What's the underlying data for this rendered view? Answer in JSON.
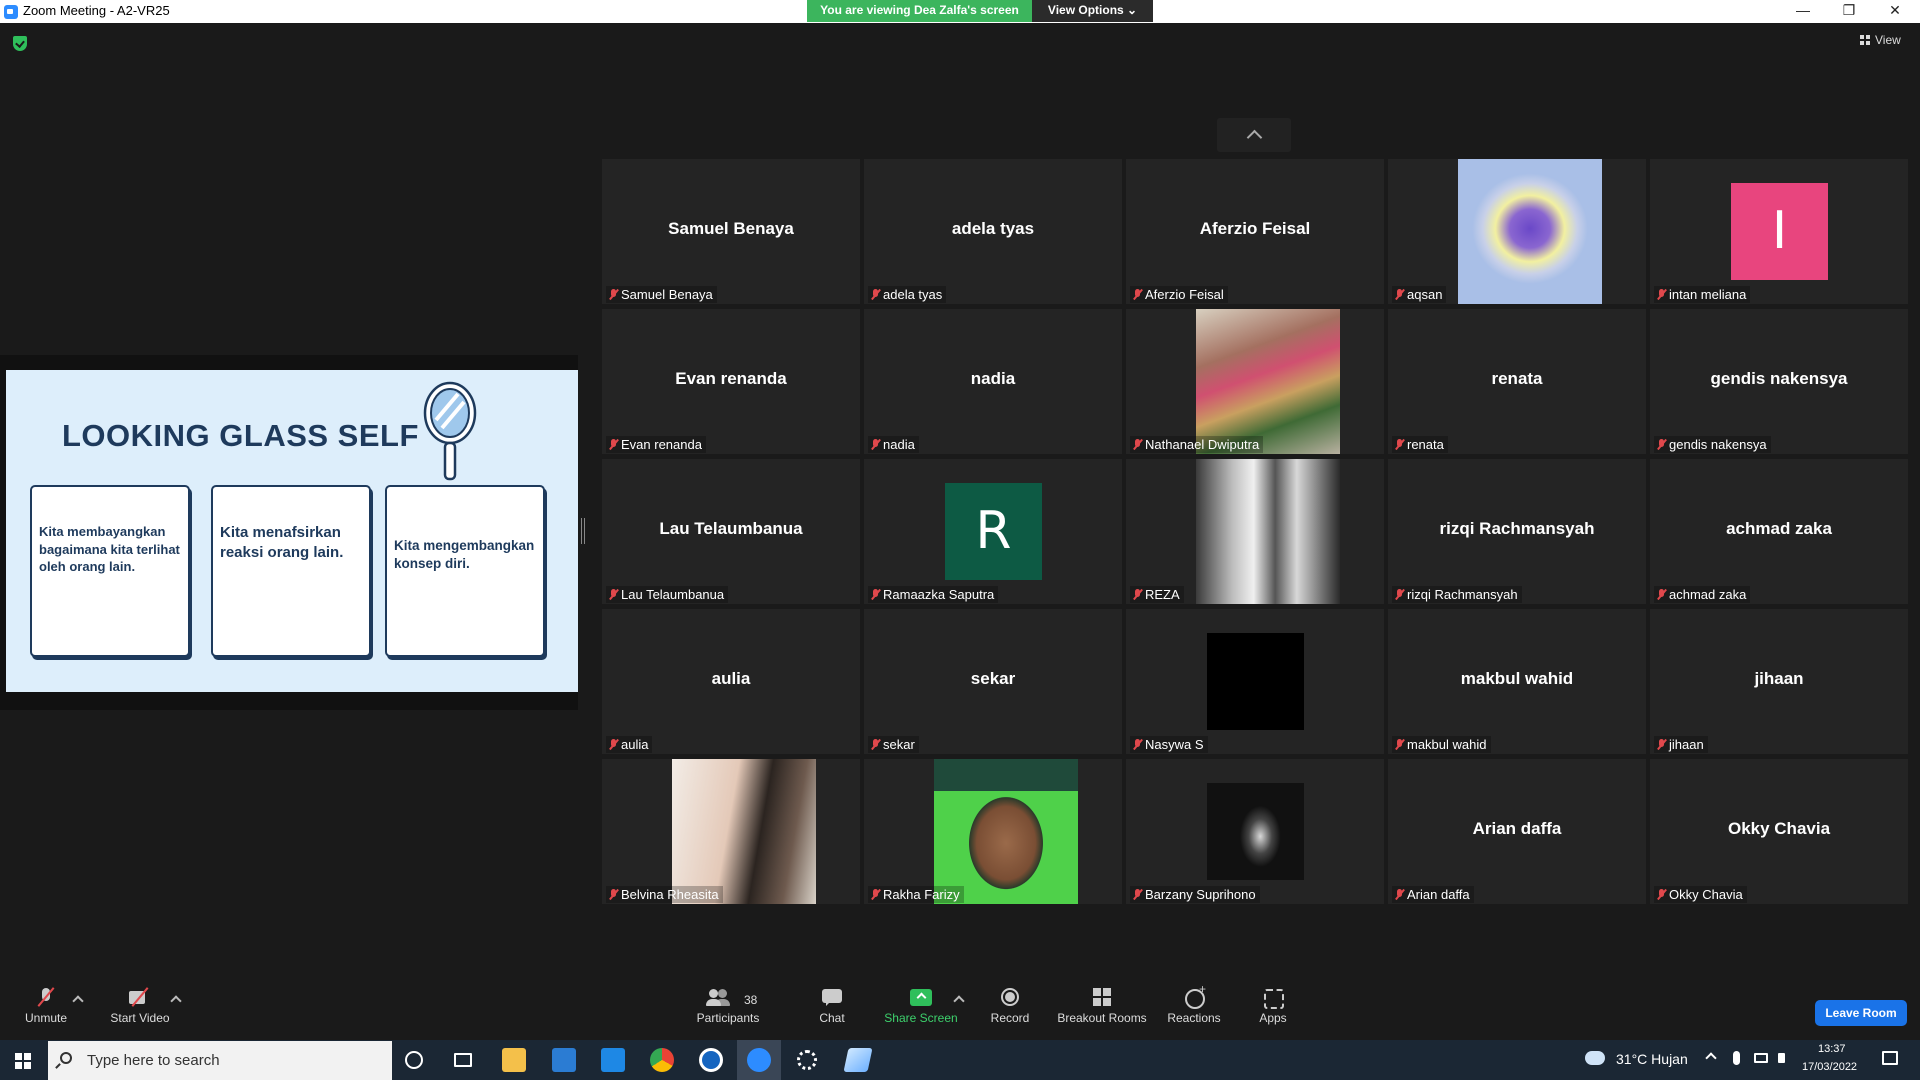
{
  "window": {
    "title": "Zoom Meeting - A2-VR25",
    "banner": "You are viewing Dea Zalfa's screen",
    "view_options": "View Options ⌄",
    "minimize": "—",
    "restore": "❐",
    "close": "✕"
  },
  "top_right": {
    "view_label": "View"
  },
  "shared_screen": {
    "title": "LOOKING GLASS SELF",
    "cards": [
      "Kita membayangkan bagaimana kita terlihat oleh orang lain.",
      "Kita menafsirkan reaksi orang lain.",
      "Kita mengembangkan konsep diri."
    ]
  },
  "gallery": {
    "tiles": [
      {
        "label": "Samuel Benaya",
        "display": "Samuel Benaya",
        "avatar": "none"
      },
      {
        "label": "adela tyas",
        "display": "adela tyas",
        "avatar": "none"
      },
      {
        "label": "Aferzio Feisal",
        "display": "Aferzio Feisal",
        "avatar": "none"
      },
      {
        "label": "aqsan",
        "display": "",
        "avatar": "heart-image"
      },
      {
        "label": "intan meliana",
        "display": "I",
        "avatar": "letter",
        "avatar_color": "#e8457e"
      },
      {
        "label": "Evan renanda",
        "display": "Evan renanda",
        "avatar": "none"
      },
      {
        "label": "nadia",
        "display": "nadia",
        "avatar": "none"
      },
      {
        "label": "Nathanael Dwiputra",
        "display": "",
        "avatar": "group-photo"
      },
      {
        "label": "renata",
        "display": "renata",
        "avatar": "none"
      },
      {
        "label": "gendis nakensya",
        "display": "gendis nakensya",
        "avatar": "none"
      },
      {
        "label": "Lau Telaumbanua",
        "display": "Lau Telaumbanua",
        "avatar": "none"
      },
      {
        "label": "Ramaazka Saputra",
        "display": "R",
        "avatar": "letter",
        "avatar_color": "#0d5a44"
      },
      {
        "label": "REZA",
        "display": "",
        "avatar": "couple-photo"
      },
      {
        "label": "rizqi Rachmansyah",
        "display": "rizqi Rachmansyah",
        "avatar": "none"
      },
      {
        "label": "achmad zaka",
        "display": "achmad zaka",
        "avatar": "none"
      },
      {
        "label": "aulia",
        "display": "aulia",
        "avatar": "none"
      },
      {
        "label": "sekar",
        "display": "sekar",
        "avatar": "none"
      },
      {
        "label": "Nasywa S",
        "display": "",
        "avatar": "black-square"
      },
      {
        "label": "makbul wahid",
        "display": "makbul wahid",
        "avatar": "none"
      },
      {
        "label": "jihaan",
        "display": "jihaan",
        "avatar": "none"
      },
      {
        "label": "Belvina Rheasita",
        "display": "",
        "avatar": "selfie-photo"
      },
      {
        "label": "Rakha Farizy",
        "display": "",
        "avatar": "portrait-photo"
      },
      {
        "label": "Barzany Suprihono",
        "display": "",
        "avatar": "bw-photo"
      },
      {
        "label": "Arian daffa",
        "display": "Arian daffa",
        "avatar": "none"
      },
      {
        "label": "Okky Chavia",
        "display": "Okky Chavia",
        "avatar": "none"
      }
    ]
  },
  "toolbar": {
    "unmute": "Unmute",
    "start_video": "Start Video",
    "participants": "Participants",
    "participants_count": "38",
    "chat": "Chat",
    "share_screen": "Share Screen",
    "record": "Record",
    "breakout_rooms": "Breakout Rooms",
    "reactions": "Reactions",
    "apps": "Apps",
    "leave": "Leave Room"
  },
  "taskbar": {
    "search_placeholder": "Type here to search",
    "weather": "31°C  Hujan",
    "time": "13:37",
    "date": "17/03/2022"
  },
  "colors": {
    "accent_green": "#3cb55d",
    "leave_blue": "#1a73e8",
    "muted_red": "#e0484c",
    "slide_bg": "#ddeefb",
    "slide_ink": "#1e3a5c"
  }
}
